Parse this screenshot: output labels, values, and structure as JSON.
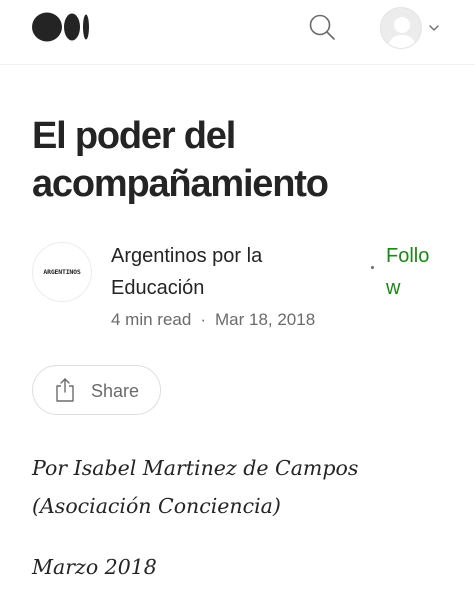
{
  "header": {
    "logo_icon": "medium-logo-icon",
    "search_icon": "search-icon",
    "avatar_icon": "user-avatar-icon",
    "menu_icon": "chevron-down-icon"
  },
  "article": {
    "title": "El poder del acompañamiento",
    "publication": {
      "name": "Argentinos por la Educación",
      "logo_text": "ARGENTINOS"
    },
    "follow_label": "Follow",
    "read_time": "4 min read",
    "separator": "·",
    "date": "Mar 18, 2018",
    "share_label": "Share",
    "paragraphs": [
      "Por Isabel Martinez de Campos (Asociación Conciencia)",
      "Marzo 2018"
    ]
  },
  "colors": {
    "text": "#242424",
    "muted": "#6b6b6b",
    "follow": "#1a8917",
    "border": "#dedede"
  }
}
